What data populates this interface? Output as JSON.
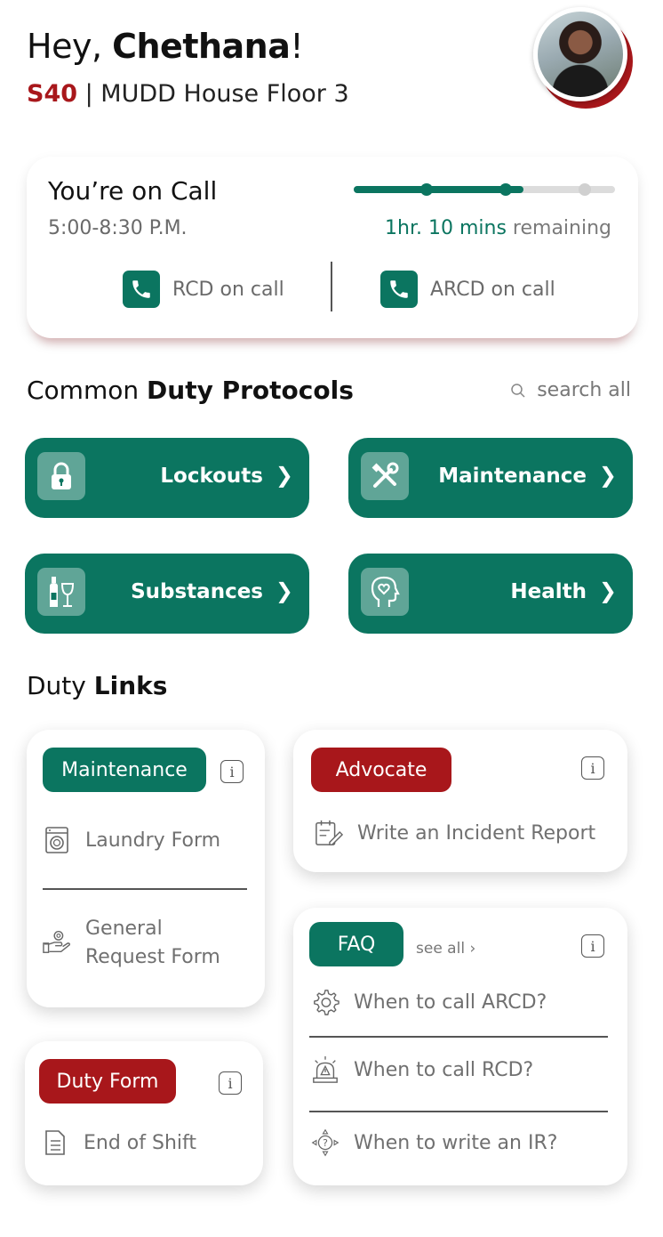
{
  "header": {
    "greeting_prefix": "Hey, ",
    "name": "Chethana",
    "greeting_suffix": "!",
    "room_code": "S40",
    "separator": " | ",
    "location": "MUDD House Floor 3"
  },
  "on_call": {
    "title": "You’re on Call",
    "time": "5:00-8:30 P.M.",
    "remaining_accent": "1hr. 10 mins",
    "remaining_text": " remaining",
    "progress_fraction": 0.65,
    "rcd_label": "RCD on call",
    "arcd_label": "ARCD on call"
  },
  "protocols": {
    "title_light": "Common ",
    "title_bold": "Duty Protocols",
    "search_label": "search all",
    "items": [
      {
        "label": "Lockouts",
        "icon": "lock-icon"
      },
      {
        "label": "Maintenance",
        "icon": "tools-icon"
      },
      {
        "label": "Substances",
        "icon": "bottle-glass-icon"
      },
      {
        "label": "Health",
        "icon": "head-heart-icon"
      }
    ]
  },
  "duty_links": {
    "title_light": "Duty ",
    "title_bold": "Links",
    "maintenance": {
      "tag": "Maintenance",
      "items": [
        "Laundry Form",
        "General",
        "Request Form"
      ]
    },
    "advocate": {
      "tag": "Advocate",
      "items": [
        "Write an Incident Report"
      ]
    },
    "faq": {
      "tag": "FAQ",
      "see_all": "see all ›",
      "items": [
        "When to call ARCD?",
        "When to call RCD?",
        "When to write an IR?"
      ]
    },
    "duty_form": {
      "tag": "Duty Form",
      "items": [
        "End of Shift"
      ]
    },
    "info_glyph": "i"
  },
  "colors": {
    "green": "#0b7560",
    "red": "#a8171b"
  }
}
